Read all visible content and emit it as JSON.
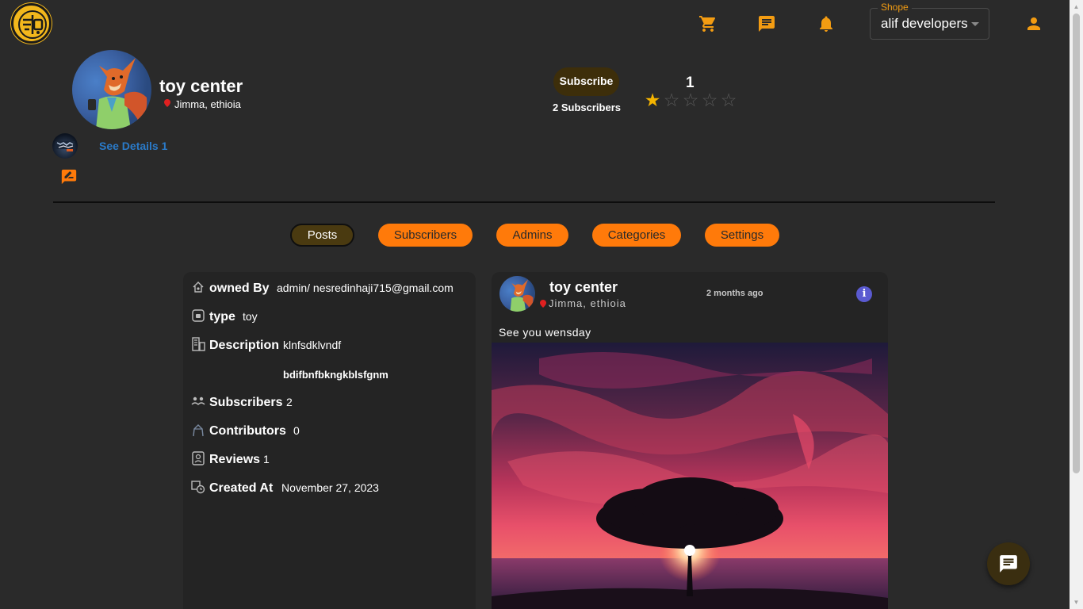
{
  "header": {
    "icons": [
      "cart-icon",
      "message-icon",
      "bell-icon",
      "account-icon"
    ],
    "shop_select": {
      "legend": "Shope",
      "value": "alif developers"
    }
  },
  "profile": {
    "name": "toy center",
    "location": "Jimma, ethioia",
    "see_details": "See Details 1",
    "subscribe_label": "Subscribe",
    "subscribers_text": "2 Subscribers",
    "rating_value": "1",
    "rating_stars_filled": 1,
    "rating_stars_total": 5
  },
  "tabs": [
    {
      "label": "Posts",
      "active": true
    },
    {
      "label": "Subscribers",
      "active": false
    },
    {
      "label": "Admins",
      "active": false
    },
    {
      "label": "Categories",
      "active": false
    },
    {
      "label": "Settings",
      "active": false
    }
  ],
  "info": {
    "owned_by_label": "owned By",
    "owned_by_value": "admin/ nesredinhaji715@gmail.com",
    "type_label": "type",
    "type_value": "toy",
    "description_label": "Description",
    "description_value": "klnfsdklvndf",
    "description_extra": "bdifbnfbkngkblsfgnm",
    "subscribers_label": "Subscribers",
    "subscribers_value": "2",
    "contributors_label": "Contributors",
    "contributors_value": "0",
    "reviews_label": "Reviews",
    "reviews_value": "1",
    "created_label": "Created At",
    "created_value": "November 27, 2023"
  },
  "post": {
    "author": "toy center",
    "location": "Jimma, ethioia",
    "time": "2 months ago",
    "text": "See you wensday",
    "info_glyph": "i"
  },
  "colors": {
    "accent": "#ff7a0a",
    "background": "#2a2a2a",
    "card": "#242424",
    "link": "#2a7ac8",
    "star": "#f5b400"
  }
}
